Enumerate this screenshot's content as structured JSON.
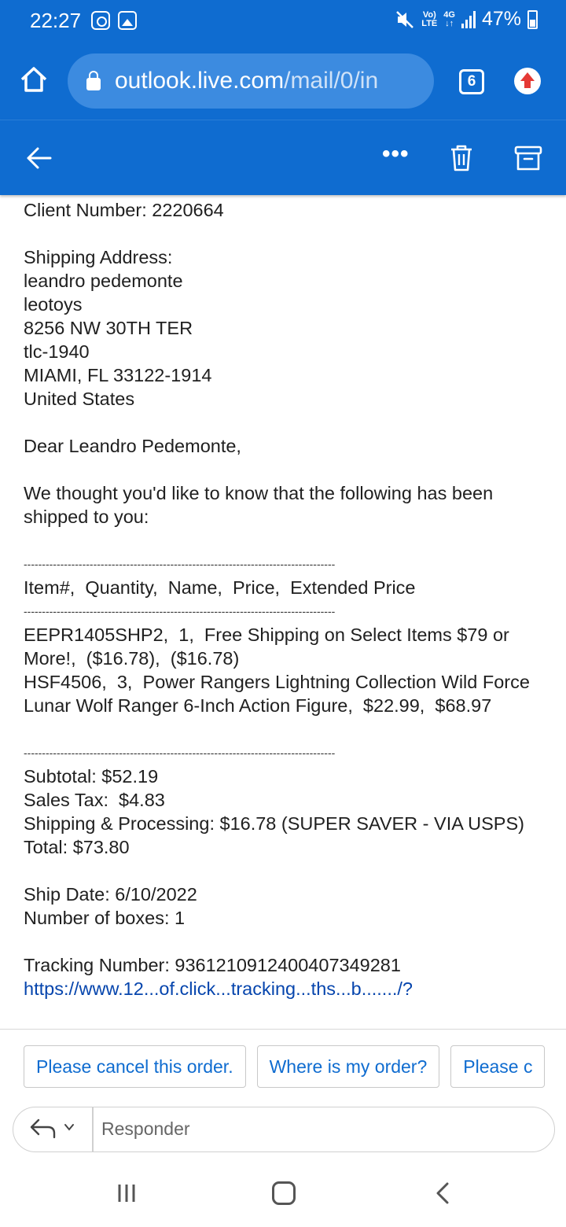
{
  "status_bar": {
    "time": "22:27",
    "network_top": "Vo)",
    "network_bottom": "LTE",
    "network_type": "4G",
    "battery": "47%"
  },
  "browser": {
    "url_host": "outlook.live.com",
    "url_path": "/mail/0/in",
    "tab_count": "6"
  },
  "toolbar": {
    "more_label": "•••"
  },
  "email": {
    "client_number": "Client Number: 2220664",
    "shipping_label": "Shipping Address:",
    "address": [
      "leandro pedemonte",
      "leotoys",
      "8256 NW 30TH TER",
      "tlc-1940",
      "MIAMI, FL 33122-1914",
      "United States"
    ],
    "greeting": "Dear Leandro Pedemonte,",
    "intro": "We thought you'd like to know that the following has been shipped to you:",
    "divider": "-------------------------------------------------------------------------------------",
    "items_header": "Item#,  Quantity,  Name,  Price,  Extended Price",
    "items": [
      "EEPR1405SHP2,  1,  Free Shipping on Select Items $79 or More!,  ($16.78),  ($16.78)",
      "HSF4506,  3,  Power Rangers Lightning Collection Wild Force Lunar Wolf Ranger 6-Inch Action Figure,  $22.99,  $68.97"
    ],
    "subtotal": "Subtotal: $52.19",
    "sales_tax": "Sales Tax:  $4.83",
    "shipping": "Shipping & Processing: $16.78 (SUPER SAVER - VIA USPS)",
    "total": "Total: $73.80",
    "ship_date": "Ship Date: 6/10/2022",
    "boxes": "Number of boxes: 1",
    "tracking": "Tracking Number: 9361210912400407349281",
    "link_peek": "https://www.12...of.click...tracking...ths...b......./?"
  },
  "suggested_replies": [
    "Please cancel this order.",
    "Where is my order?",
    "Please c"
  ],
  "reply": {
    "placeholder": "Responder"
  },
  "colors": {
    "brand": "#0F6CD0",
    "link": "#0F6CD0"
  }
}
